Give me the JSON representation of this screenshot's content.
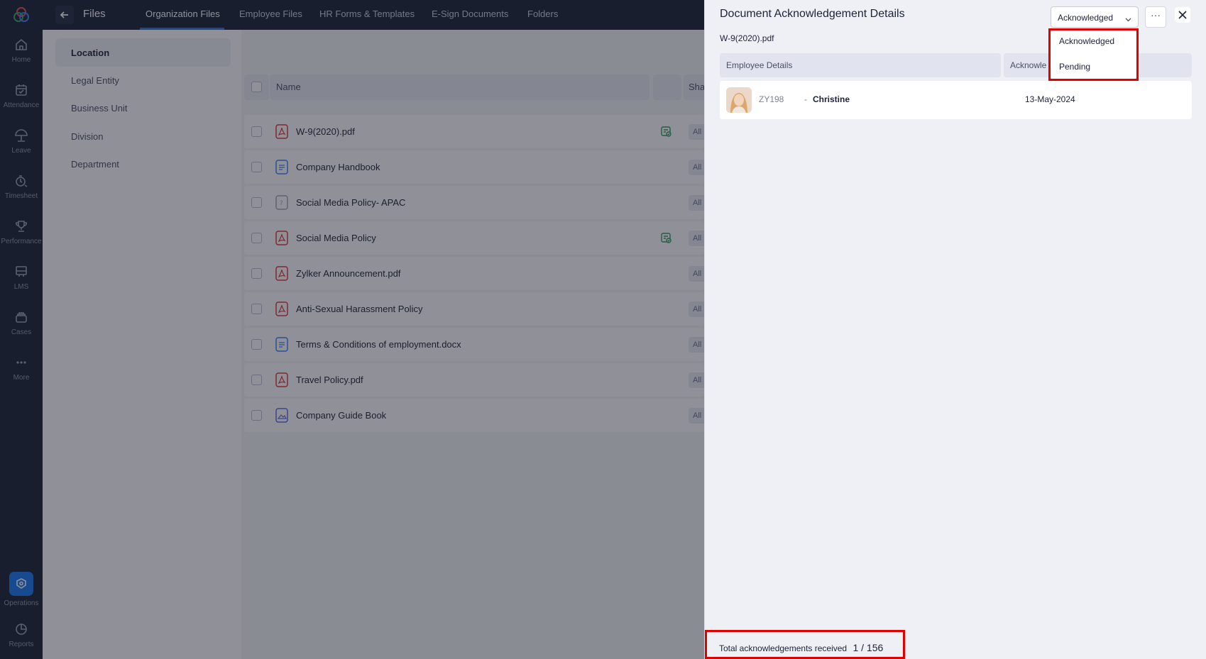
{
  "rail": {
    "items": [
      {
        "label": "Home",
        "icon": "home-icon"
      },
      {
        "label": "Attendance",
        "icon": "calendar-icon"
      },
      {
        "label": "Leave",
        "icon": "umbrella-icon"
      },
      {
        "label": "Timesheet",
        "icon": "timer-icon"
      },
      {
        "label": "Performance",
        "icon": "trophy-icon"
      },
      {
        "label": "LMS",
        "icon": "board-icon"
      },
      {
        "label": "Cases",
        "icon": "cases-icon"
      },
      {
        "label": "More",
        "icon": "more-icon"
      }
    ],
    "bottom_items": [
      {
        "label": "Operations",
        "icon": "operations-icon"
      },
      {
        "label": "Reports",
        "icon": "reports-icon"
      }
    ]
  },
  "topbar": {
    "title": "Files",
    "tabs": [
      "Organization Files",
      "Employee Files",
      "HR Forms & Templates",
      "E-Sign Documents",
      "Folders"
    ],
    "active_tab": "Organization Files"
  },
  "filters": {
    "items": [
      "Location",
      "Legal Entity",
      "Business Unit",
      "Division",
      "Department"
    ],
    "active": "Location"
  },
  "file_list": {
    "headers": {
      "name": "Name",
      "share": "Sha"
    },
    "rows": [
      {
        "name": "W-9(2020).pdf",
        "type": "pdf",
        "ack": true,
        "share": "All"
      },
      {
        "name": "Company Handbook",
        "type": "doc",
        "ack": false,
        "share": "All"
      },
      {
        "name": "Social Media Policy- APAC",
        "type": "unknown",
        "ack": false,
        "share": "All"
      },
      {
        "name": "Social Media Policy",
        "type": "pdf",
        "ack": true,
        "share": "All"
      },
      {
        "name": "Zylker Announcement.pdf",
        "type": "pdf",
        "ack": false,
        "share": "All"
      },
      {
        "name": "Anti-Sexual Harassment Policy",
        "type": "pdf",
        "ack": false,
        "share": "All"
      },
      {
        "name": "Terms & Conditions of employment.docx",
        "type": "doc",
        "ack": false,
        "share": "All"
      },
      {
        "name": "Travel Policy.pdf",
        "type": "pdf",
        "ack": false,
        "share": "All"
      },
      {
        "name": "Company Guide Book",
        "type": "image",
        "ack": false,
        "share": "All"
      }
    ]
  },
  "drawer": {
    "title": "Document Acknowledgement Details",
    "file_name": "W-9(2020).pdf",
    "status_select": "Acknowledged",
    "more_label": "···",
    "columns": [
      "Employee Details",
      "Acknowle"
    ],
    "rows": [
      {
        "emp_id": "ZY198",
        "separator": "-",
        "emp_name": "Christine",
        "date": "13-May-2024"
      }
    ],
    "dropdown_options": [
      "Acknowledged",
      "Pending"
    ],
    "footer_label": "Total acknowledgements received",
    "footer_count": "1 / 156"
  },
  "colors": {
    "rail_bg": "#1c2337",
    "accent": "#1877f2",
    "highlight": "#e00000",
    "ack_green": "#2f9e5b",
    "pdf_red": "#d93a3a",
    "doc_blue": "#3b82f6"
  }
}
